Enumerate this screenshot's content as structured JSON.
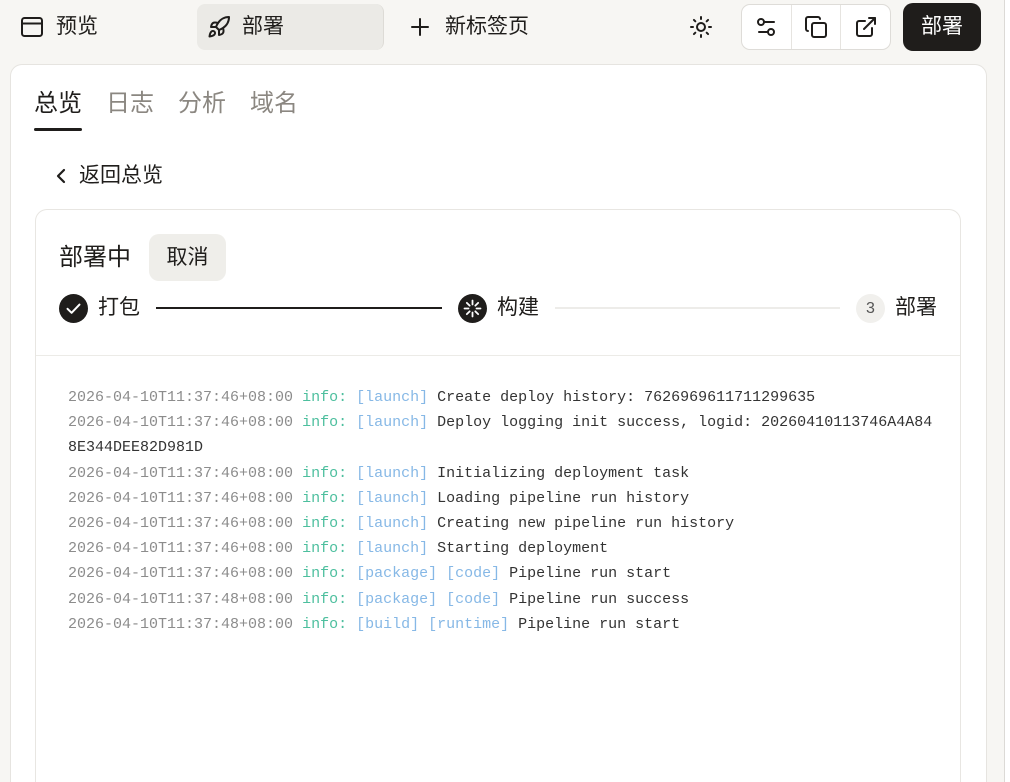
{
  "topbar": {
    "preview": {
      "label": "预览",
      "icon": "browser-window-icon"
    },
    "active_tab": {
      "label": "部署",
      "icon": "rocket-icon"
    },
    "new_tab": {
      "label": "新标签页",
      "icon": "plus-icon"
    },
    "theme_toggle_icon": "sun-icon",
    "tool_icons": [
      "sliders-icon",
      "copy-icon",
      "external-link-icon"
    ],
    "deploy_button": "部署"
  },
  "main": {
    "tabs": [
      {
        "label": "总览",
        "active": true
      },
      {
        "label": "日志",
        "active": false
      },
      {
        "label": "分析",
        "active": false
      },
      {
        "label": "域名",
        "active": false
      }
    ],
    "back_link": {
      "label": "返回总览",
      "icon": "chevron-left-icon"
    },
    "deployment": {
      "status": "部署中",
      "cancel_button": "取消",
      "steps": [
        {
          "label": "打包",
          "state": "done",
          "icon": "check-icon"
        },
        {
          "label": "构建",
          "state": "in-progress",
          "icon": "spinner-icon"
        },
        {
          "label": "部署",
          "state": "pending",
          "number": "3"
        }
      ],
      "logs": [
        {
          "timestamp": "2026-04-10T11:37:46+08:00",
          "level": "info:",
          "tags": [
            "[launch]"
          ],
          "message": "Create deploy history: 7626969611711299635"
        },
        {
          "timestamp": "2026-04-10T11:37:46+08:00",
          "level": "info:",
          "tags": [
            "[launch]"
          ],
          "message": "Deploy logging init success, logid: 20260410113746A4A848E344DEE82D981D"
        },
        {
          "timestamp": "2026-04-10T11:37:46+08:00",
          "level": "info:",
          "tags": [
            "[launch]"
          ],
          "message": "Initializing deployment task"
        },
        {
          "timestamp": "2026-04-10T11:37:46+08:00",
          "level": "info:",
          "tags": [
            "[launch]"
          ],
          "message": "Loading pipeline run history"
        },
        {
          "timestamp": "2026-04-10T11:37:46+08:00",
          "level": "info:",
          "tags": [
            "[launch]"
          ],
          "message": "Creating new pipeline run history"
        },
        {
          "timestamp": "2026-04-10T11:37:46+08:00",
          "level": "info:",
          "tags": [
            "[launch]"
          ],
          "message": "Starting deployment"
        },
        {
          "timestamp": "2026-04-10T11:37:46+08:00",
          "level": "info:",
          "tags": [
            "[package]",
            "[code]"
          ],
          "message": "Pipeline run start"
        },
        {
          "timestamp": "2026-04-10T11:37:48+08:00",
          "level": "info:",
          "tags": [
            "[package]",
            "[code]"
          ],
          "message": "Pipeline run success"
        },
        {
          "timestamp": "2026-04-10T11:37:48+08:00",
          "level": "info:",
          "tags": [
            "[build]",
            "[runtime]"
          ],
          "message": "Pipeline run start"
        }
      ]
    }
  },
  "colors": {
    "page_background": "#f7f6f3",
    "text_primary": "#1f1d1b",
    "text_muted": "#8b8781",
    "primary_button": "#1f1d1b",
    "log_timestamp": "#8c8c8c",
    "log_level_info": "#4dbf9e",
    "log_tag": "#86b8e6",
    "log_message": "#333333"
  }
}
